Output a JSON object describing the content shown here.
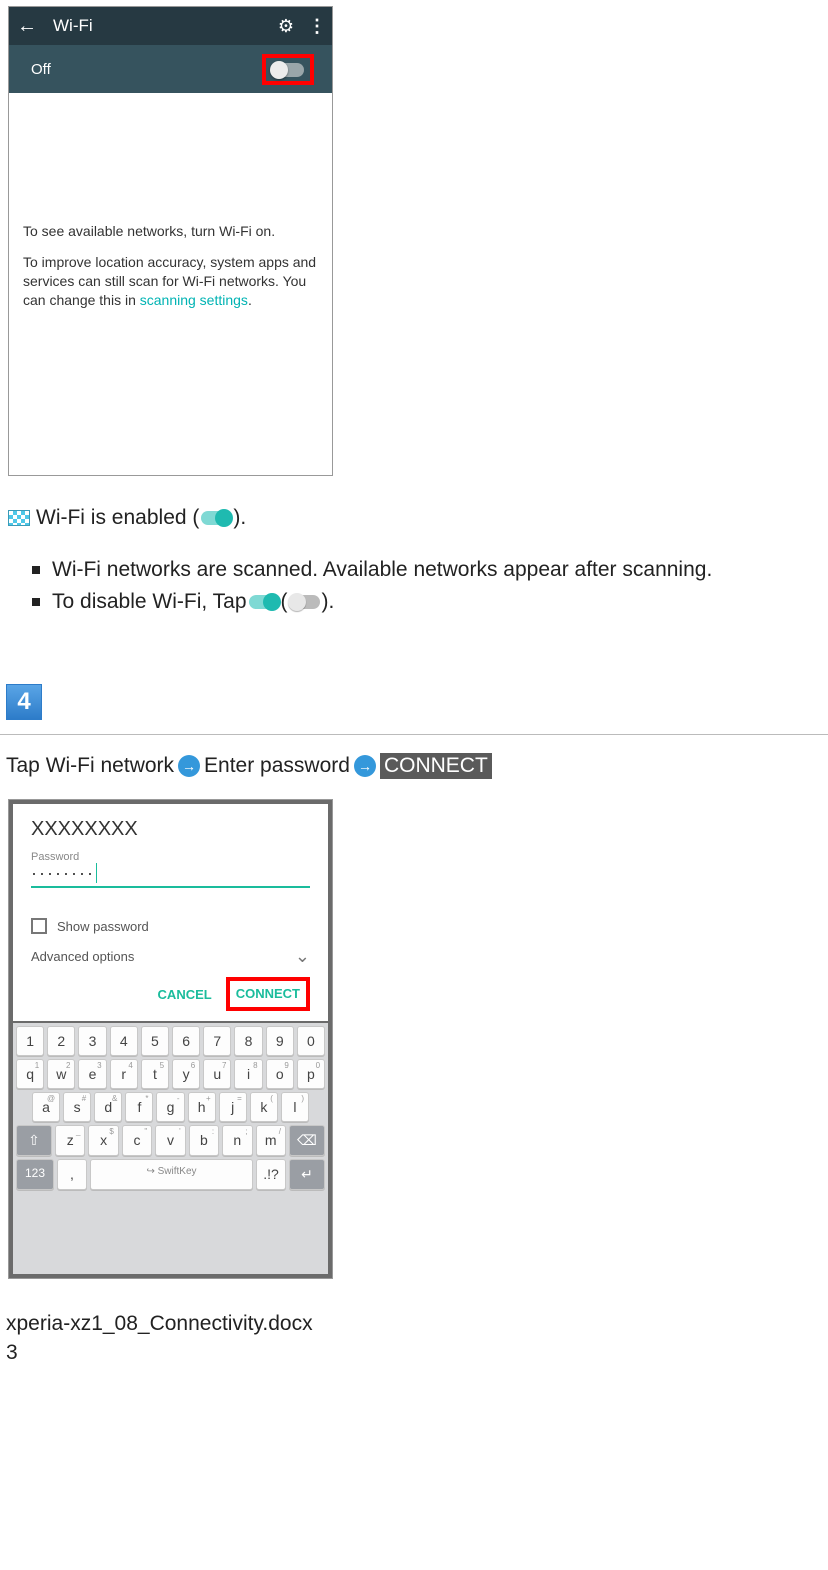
{
  "phone1": {
    "title": "Wi-Fi",
    "toggle_label": "Off",
    "body_line1": "To see available networks, turn Wi-Fi on.",
    "body_line2a": "To improve location accuracy, system apps and services can still scan for Wi-Fi networks. You can change this in ",
    "body_link": "scanning settings",
    "body_line2b": "."
  },
  "enabled_line": {
    "prefix": " Wi-Fi is enabled (",
    "suffix": ")."
  },
  "bullets": {
    "b1": "Wi-Fi networks are scanned. Available networks appear after scanning.",
    "b2a": "To disable Wi-Fi, Tap  ",
    "b2b": "  (",
    "b2c": ")."
  },
  "step4_num": "4",
  "step4": {
    "t1": "Tap Wi-Fi network",
    "t2": "Enter password",
    "connect": "CONNECT"
  },
  "dialog": {
    "network": "XXXXXXXX",
    "pw_label": "Password",
    "pw_dots": "········",
    "show_pw": "Show password",
    "adv": "Advanced options",
    "cancel": "CANCEL",
    "connect": "CONNECT"
  },
  "keyboard": {
    "row1": [
      "1",
      "2",
      "3",
      "4",
      "5",
      "6",
      "7",
      "8",
      "9",
      "0"
    ],
    "row2": [
      "q",
      "w",
      "e",
      "r",
      "t",
      "y",
      "u",
      "i",
      "o",
      "p"
    ],
    "row2_sup": [
      "1",
      "2",
      "3",
      "4",
      "5",
      "6",
      "7",
      "8",
      "9",
      "0"
    ],
    "row3": [
      "a",
      "s",
      "d",
      "f",
      "g",
      "h",
      "j",
      "k",
      "l"
    ],
    "row3_sup": [
      "@",
      "#",
      "&",
      "*",
      "-",
      "+",
      "=",
      "(",
      ")"
    ],
    "row4": [
      "z",
      "x",
      "c",
      "v",
      "b",
      "n",
      "m"
    ],
    "row4_sup": [
      "_",
      "$",
      "\"",
      "'",
      ":",
      ";",
      "/"
    ],
    "k123": "123",
    "space": "SwiftKey",
    "shift": "⇧",
    "back": "⌫",
    "enter": "↵",
    "comma": ",",
    "dot": ".!?"
  },
  "footer": {
    "filename": "xperia-xz1_08_Connectivity.docx",
    "page": "3"
  }
}
